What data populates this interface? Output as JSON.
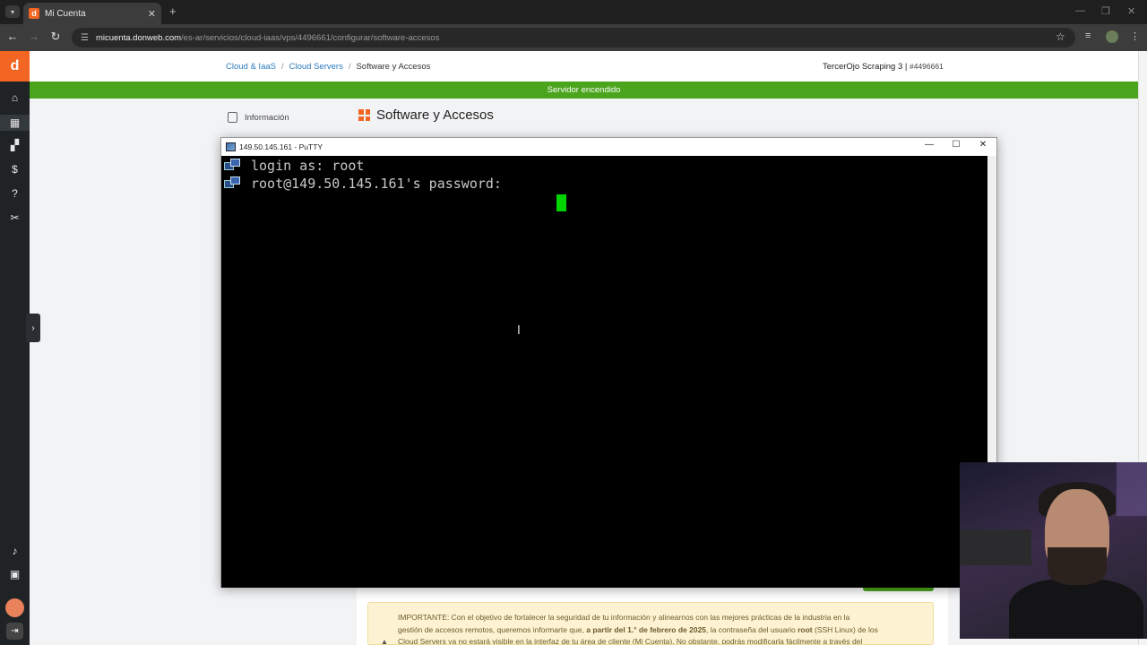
{
  "browser": {
    "tab_title": "Mi Cuenta",
    "tab_close": "✕",
    "new_tab": "+",
    "url_host": "micuenta.donweb.com",
    "url_path": "/es-ar/servicios/cloud-iaas/vps/4496661/configurar/software-accesos"
  },
  "app": {
    "logo": "d"
  },
  "page": {
    "breadcrumb": {
      "item1": "Cloud & IaaS",
      "item2": "Cloud Servers",
      "item3": "Software y Accesos",
      "sep": "/"
    },
    "server_name": "TercerOjo Scraping 3 |",
    "server_id": "#4496661",
    "status": "Servidor encendido",
    "side_menu": {
      "info": "Información"
    },
    "section_title": "Software y Accesos",
    "notice": {
      "line1": "IMPORTANTE: Con el objetivo de fortalecer la seguridad de tu información y alinearnos con las mejores prácticas de la industria en la",
      "line2a": "gestión de accesos remotos, queremos informarte que, ",
      "line2b": "a partir del 1.° de febrero de 2025",
      "line2c": ", la contraseña del usuario ",
      "line2d": "root",
      "line2e": " (SSH Linux) de los",
      "line3": "Cloud Servers ya no estará visible en la interfaz de tu área de cliente (Mi Cuenta). No obstante, podrás modificarla fácilmente a través del"
    }
  },
  "putty": {
    "title": "149.50.145.161 - PuTTY",
    "line1": "login as: root",
    "line2": "root@149.50.145.161's password: "
  },
  "colors": {
    "brand": "#f26522",
    "status_green": "#4aa51d",
    "terminal_cursor": "#00d400"
  }
}
